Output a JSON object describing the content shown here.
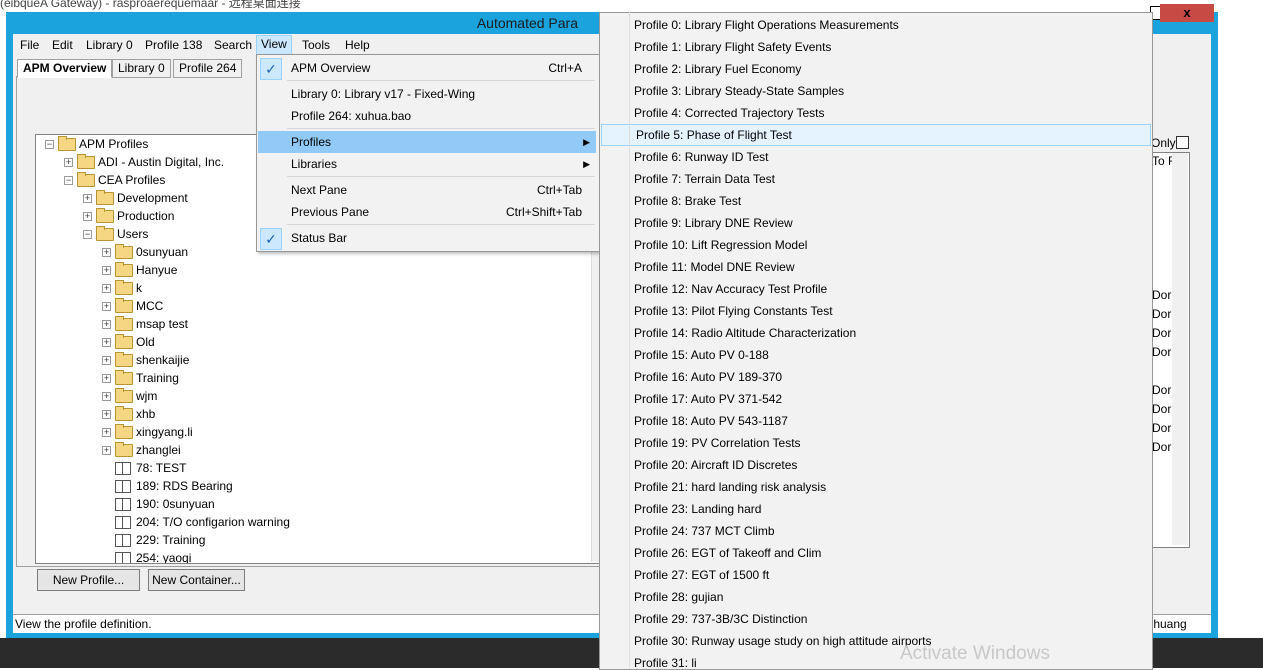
{
  "window": {
    "top_strip_text": "(eibqueA Gateway) - rasproaerequemaar - 远程桌面连接",
    "title": "Automated Para",
    "close_label": "x",
    "window_btn": "▢"
  },
  "menubar": [
    "File",
    "Edit",
    "Library 0",
    "Profile 138",
    "Search",
    "View",
    "Tools",
    "Help"
  ],
  "tabs": [
    "APM Overview",
    "Library 0",
    "Profile 264"
  ],
  "tree": [
    {
      "label": "APM Profiles",
      "level": 0,
      "kind": "folder",
      "expander": "−"
    },
    {
      "label": "ADI - Austin Digital, Inc.",
      "level": 1,
      "kind": "folder",
      "expander": "+"
    },
    {
      "label": "CEA Profiles",
      "level": 1,
      "kind": "folder",
      "expander": "−"
    },
    {
      "label": "Development",
      "level": 2,
      "kind": "folder",
      "expander": "+"
    },
    {
      "label": "Production",
      "level": 2,
      "kind": "folder",
      "expander": "+"
    },
    {
      "label": "Users",
      "level": 2,
      "kind": "folder",
      "expander": "−"
    },
    {
      "label": "0sunyuan",
      "level": 3,
      "kind": "folder",
      "expander": "+"
    },
    {
      "label": "Hanyue",
      "level": 3,
      "kind": "folder",
      "expander": "+"
    },
    {
      "label": "k",
      "level": 3,
      "kind": "folder",
      "expander": "+"
    },
    {
      "label": "MCC",
      "level": 3,
      "kind": "folder",
      "expander": "+"
    },
    {
      "label": "msap test",
      "level": 3,
      "kind": "folder",
      "expander": "+"
    },
    {
      "label": "Old",
      "level": 3,
      "kind": "folder",
      "expander": "+"
    },
    {
      "label": "shenkaijie",
      "level": 3,
      "kind": "folder",
      "expander": "+"
    },
    {
      "label": "Training",
      "level": 3,
      "kind": "folder",
      "expander": "+"
    },
    {
      "label": "wjm",
      "level": 3,
      "kind": "folder",
      "expander": "+"
    },
    {
      "label": "xhb",
      "level": 3,
      "kind": "folder",
      "expander": "+"
    },
    {
      "label": "xingyang.li",
      "level": 3,
      "kind": "folder",
      "expander": "+"
    },
    {
      "label": "zhanglei",
      "level": 3,
      "kind": "folder",
      "expander": "+"
    },
    {
      "label": "78: TEST",
      "level": 3,
      "kind": "profile",
      "expander": ""
    },
    {
      "label": "189: RDS Bearing",
      "level": 3,
      "kind": "profile",
      "expander": ""
    },
    {
      "label": "190: 0sunyuan",
      "level": 3,
      "kind": "profile",
      "expander": ""
    },
    {
      "label": "204: T/O configarion warning",
      "level": 3,
      "kind": "profile",
      "expander": ""
    },
    {
      "label": "229: Training",
      "level": 3,
      "kind": "profile",
      "expander": ""
    },
    {
      "label": "254: yaoqi",
      "level": 3,
      "kind": "profile",
      "expander": ""
    }
  ],
  "buttons": {
    "new_profile": "New Profile...",
    "new_container": "New Container..."
  },
  "status": {
    "text": "View the profile definition.",
    "right": ".huang"
  },
  "view_menu": [
    {
      "label": "APM Overview",
      "shortcut": "Ctrl+A",
      "checked": true
    },
    {
      "label": "Library 0: Library v17 - Fixed-Wing",
      "shortcut": ""
    },
    {
      "label": "Profile 264: xuhua.bao",
      "shortcut": ""
    },
    {
      "label": "Profiles",
      "shortcut": "",
      "submenu": true
    },
    {
      "label": "Libraries",
      "shortcut": "",
      "submenu": true
    },
    {
      "label": "Next Pane",
      "shortcut": "Ctrl+Tab"
    },
    {
      "label": "Previous Pane",
      "shortcut": "Ctrl+Shift+Tab"
    },
    {
      "label": "Status Bar",
      "shortcut": "",
      "checked": true
    }
  ],
  "profiles_menu": [
    "Profile 0: Library Flight Operations Measurements",
    "Profile 1: Library Flight Safety Events",
    "Profile 2: Library Fuel Economy",
    "Profile 3: Library Steady-State Samples",
    "Profile 4: Corrected Trajectory Tests",
    "Profile 5: Phase of Flight Test",
    "Profile 6: Runway ID Test",
    "Profile 7: Terrain Data Test",
    "Profile 8: Brake Test",
    "Profile 9: Library DNE Review",
    "Profile 10: Lift Regression Model",
    "Profile 11: Model DNE Review",
    "Profile 12: Nav Accuracy Test Profile",
    "Profile 13: Pilot Flying Constants Test",
    "Profile 14: Radio Altitude Characterization",
    "Profile 15: Auto PV 0-188",
    "Profile 16: Auto PV 189-370",
    "Profile 17: Auto PV 371-542",
    "Profile 18: Auto PV 543-1187",
    "Profile 19: PV Correlation Tests",
    "Profile 20: Aircraft ID Discretes",
    "Profile 21: hard landing risk analysis",
    "Profile 23: Landing hard",
    "Profile 24: 737 MCT Climb",
    "Profile 26: EGT of Takeoff and Clim",
    "Profile 27: EGT of 1500 ft",
    "Profile 28: gujian",
    "Profile 29: 737-3B/3C Distinction",
    "Profile 30: Runway usage study on high attitude airports",
    "Profile 31: li"
  ],
  "right_panel": {
    "only_label": "Only",
    "to_label": "To F",
    "dor": [
      "Dor",
      "Dor",
      "Dor",
      "Dor",
      "Dor",
      "Dor",
      "Dor",
      "Dor"
    ]
  },
  "watermark": "Activate Windows",
  "icons": {
    "check": "checkmark-icon",
    "submenu": "chevron-right-icon",
    "folder": "folder-icon",
    "profile": "book-icon"
  }
}
